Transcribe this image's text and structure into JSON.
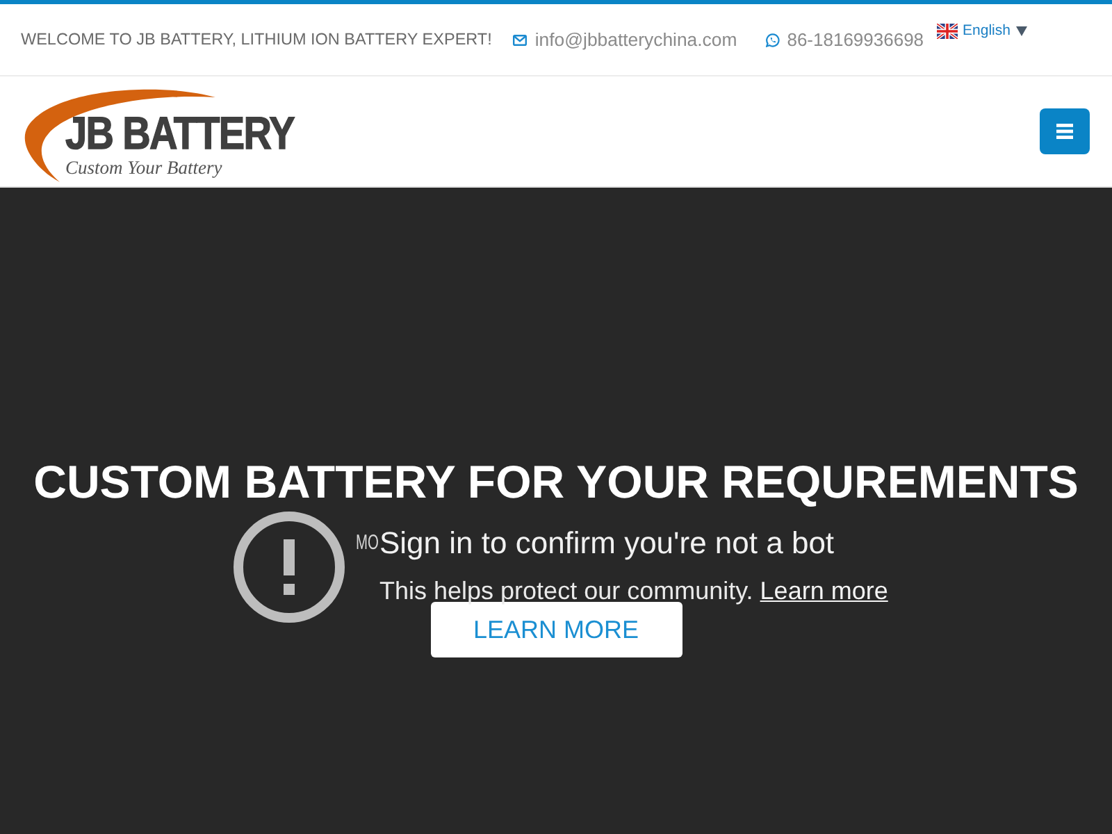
{
  "top_bar": {
    "welcome": "WELCOME TO JB BATTERY, LITHIUM ION BATTERY EXPERT!",
    "email": "info@jbbatterychina.com",
    "phone": "86-18169936698",
    "language": "English"
  },
  "header": {
    "logo": {
      "name": "JB BATTERY",
      "tagline": "Custom Your Battery"
    }
  },
  "hero": {
    "title": "CUSTOM BATTERY FOR YOUR REQUREMENTS",
    "subtitle": "MO",
    "button": "LEARN MORE"
  },
  "video_error": {
    "title": "Sign in to confirm you're not a bot",
    "message": "This helps protect our community.",
    "link": "Learn more"
  }
}
